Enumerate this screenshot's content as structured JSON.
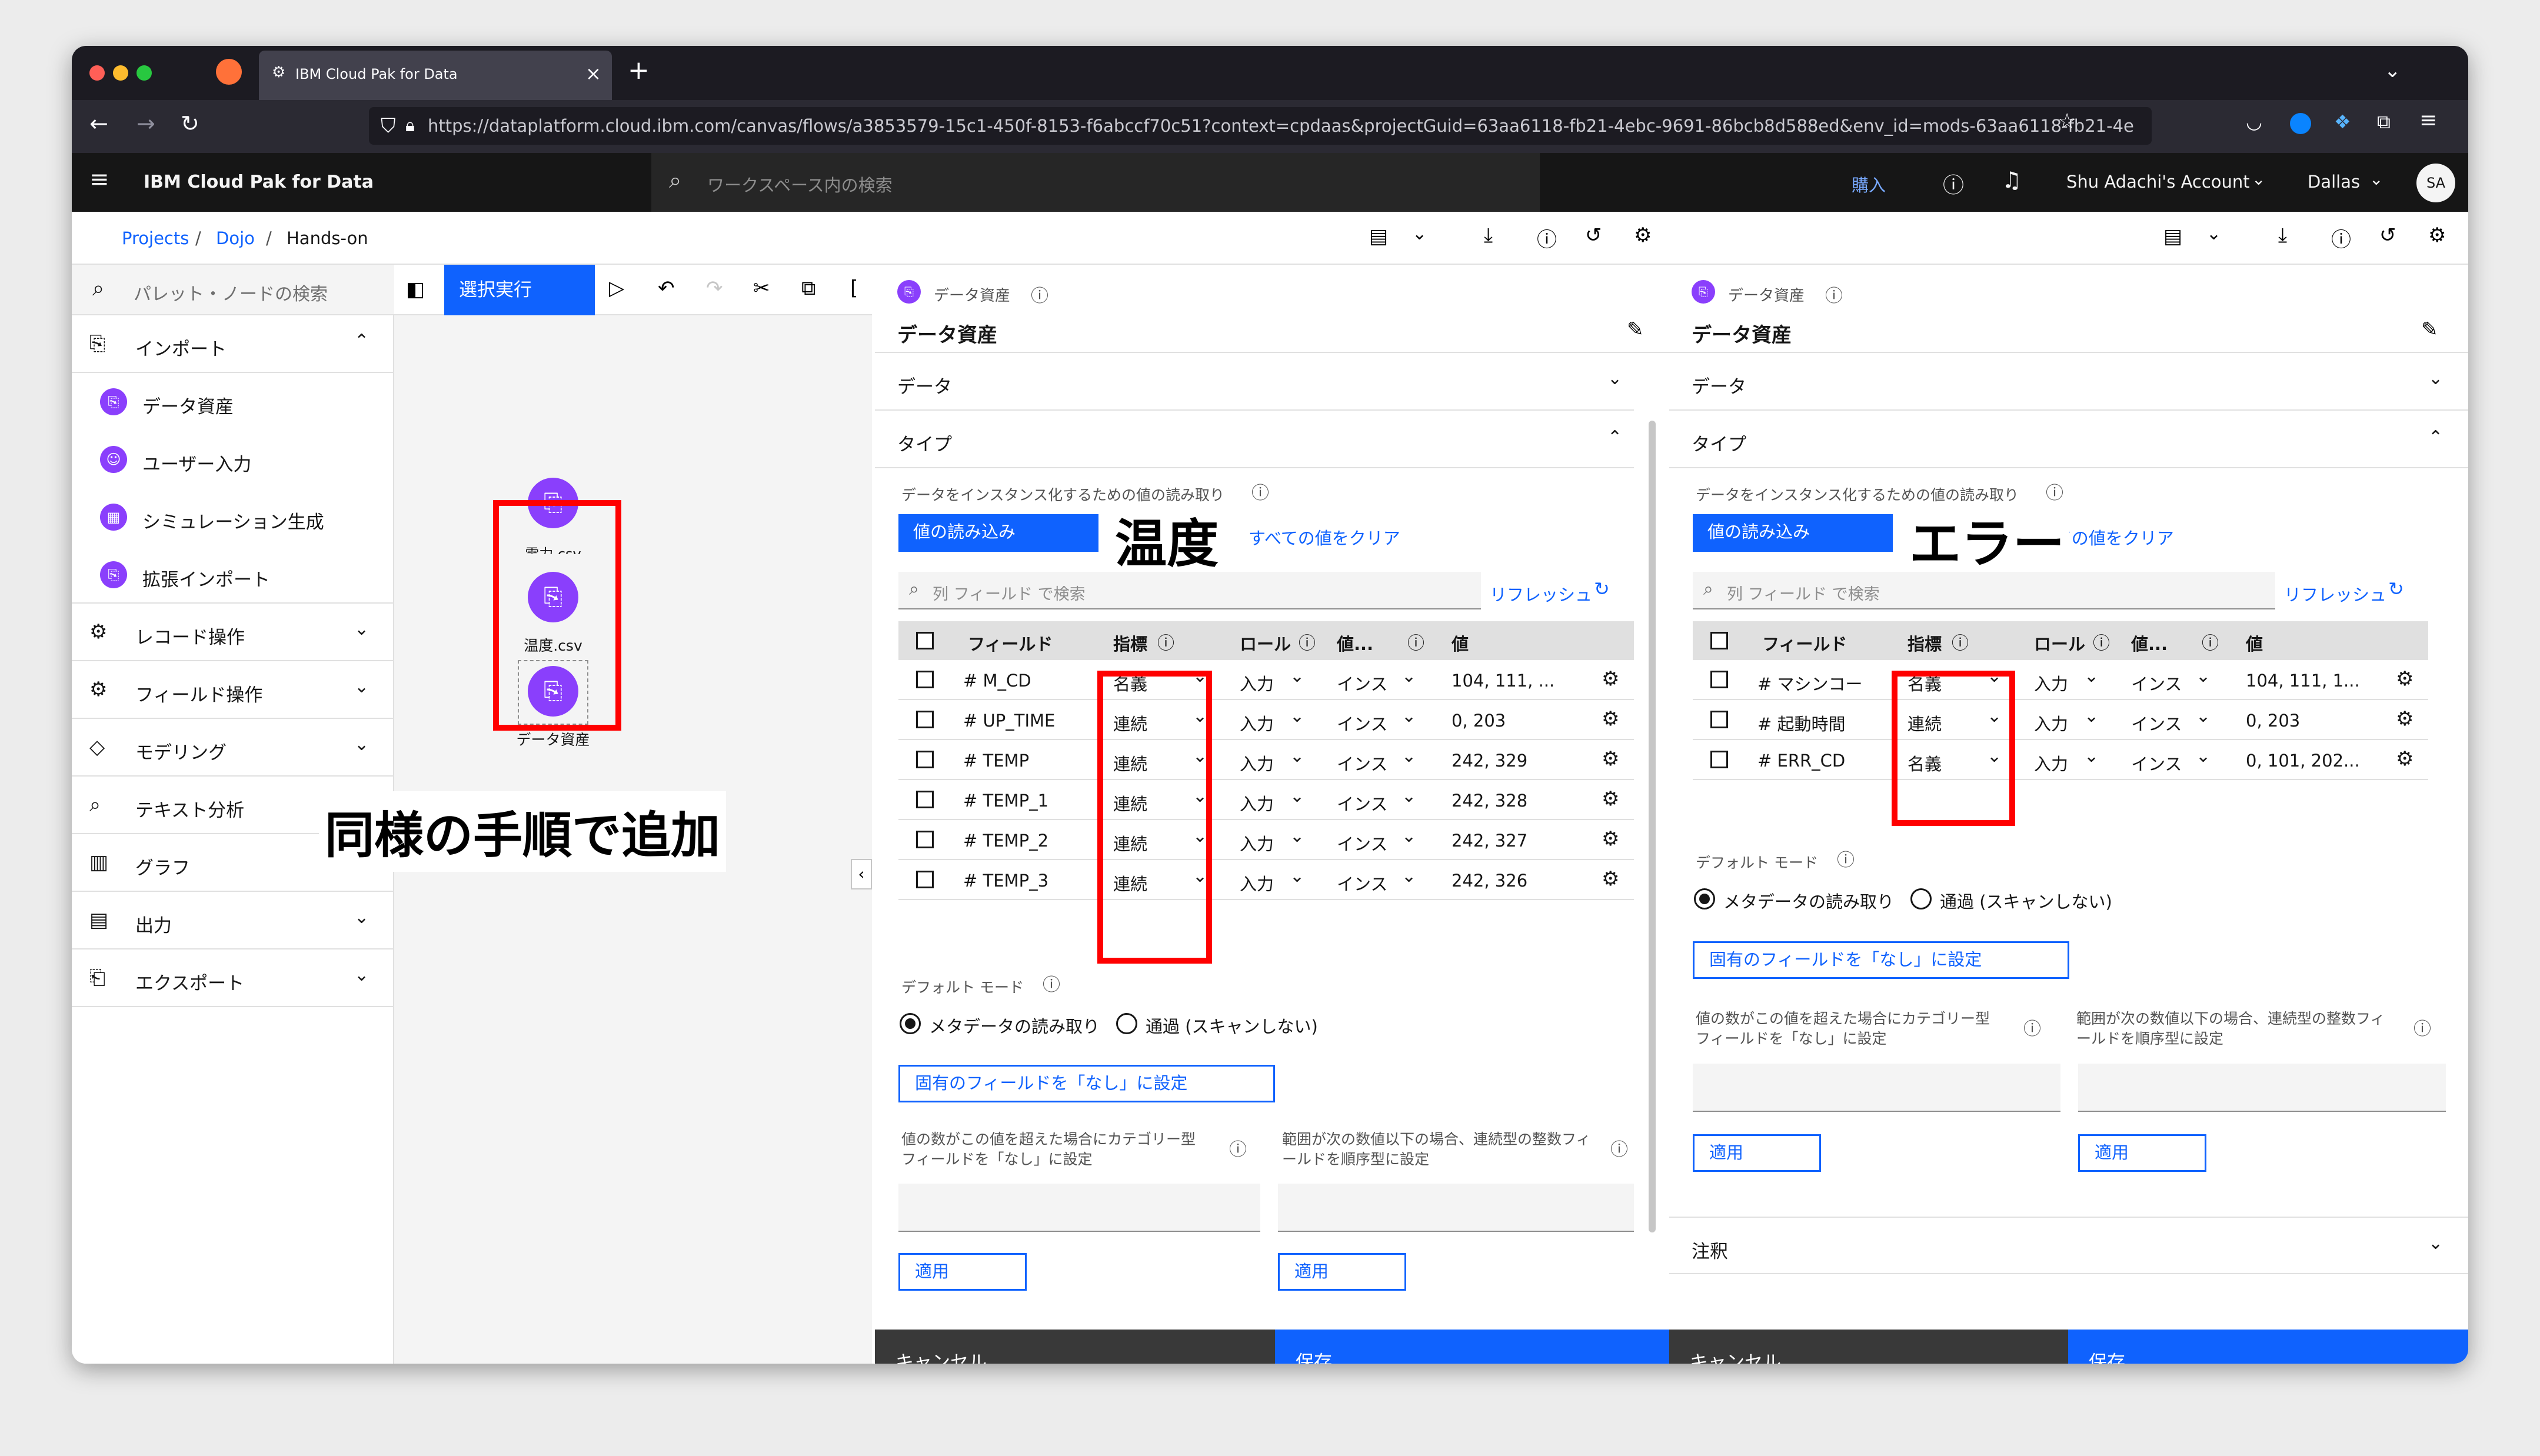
{
  "browser": {
    "tab_title": "IBM Cloud Pak for Data",
    "url": "https://dataplatform.cloud.ibm.com/canvas/flows/a3853579-15c1-450f-8153-f6abccf70c51?context=cpdaas&projectGuid=63aa6118-fb21-4ebc-9691-86bcb8d588ed&env_id=mods-63aa6118-fb21-4e"
  },
  "header": {
    "product": "IBM Cloud Pak for Data",
    "search_placeholder": "ワークスペース内の検索",
    "buy": "購入",
    "account": "Shu Adachi's Account",
    "region": "Dallas",
    "avatar": "SA"
  },
  "breadcrumb": [
    "Projects",
    "/",
    "Dojo",
    "/",
    "Hands-on"
  ],
  "palette": {
    "search_placeholder": "パレット・ノードの検索",
    "sections": [
      {
        "label": "インポート"
      },
      {
        "label": "レコード操作"
      },
      {
        "label": "フィールド操作"
      },
      {
        "label": "モデリング"
      },
      {
        "label": "テキスト分析"
      },
      {
        "label": "グラフ"
      },
      {
        "label": "出力"
      },
      {
        "label": "エクスポート"
      }
    ],
    "import_items": [
      "データ資産",
      "ユーザー入力",
      "シミュレーション生成",
      "拡張インポート"
    ]
  },
  "canvas": {
    "run_selected": "選択実行",
    "nodes": [
      "電力.csv",
      "温度.csv",
      "データ資産"
    ],
    "annotation": "同様の手順で追加"
  },
  "panel_left": {
    "subtitle": "データ資産",
    "title": "データ資産",
    "acc_data": "データ",
    "acc_type": "タイプ",
    "read_values_label": "データをインスタンス化するための値の読み取り",
    "read_values_btn": "値の読み込み",
    "clear_values": "すべての値をクリア",
    "annotation": "温度",
    "search_placeholder": "列 フィールド で検索",
    "refresh": "リフレッシュ",
    "columns": [
      "フィールド",
      "指標",
      "ロール",
      "値...",
      "値"
    ],
    "rows": [
      {
        "field": "# M_CD",
        "measure": "名義",
        "role": "入力",
        "vtype": "インス",
        "value": "104, 111, ..."
      },
      {
        "field": "# UP_TIME",
        "measure": "連続",
        "role": "入力",
        "vtype": "インス",
        "value": "0, 203"
      },
      {
        "field": "# TEMP",
        "measure": "連続",
        "role": "入力",
        "vtype": "インス",
        "value": "242, 329"
      },
      {
        "field": "# TEMP_1",
        "measure": "連続",
        "role": "入力",
        "vtype": "インス",
        "value": "242, 328"
      },
      {
        "field": "# TEMP_2",
        "measure": "連続",
        "role": "入力",
        "vtype": "インス",
        "value": "242, 327"
      },
      {
        "field": "# TEMP_3",
        "measure": "連続",
        "role": "入力",
        "vtype": "インス",
        "value": "242, 326"
      }
    ],
    "default_mode": "デフォルト モード",
    "radio_read": "メタデータの読み取り",
    "radio_pass": "通過 (スキャンしない)",
    "set_none_btn": "固有のフィールドを「なし」に設定",
    "cat_note": "値の数がこの値を超えた場合にカテゴリー型フィールドを「なし」に設定",
    "ord_note": "範囲が次の数値以下の場合、連続型の整数フィールドを順序型に設定",
    "apply": "適用",
    "cancel": "キャンセル",
    "save": "保存"
  },
  "panel_right": {
    "subtitle": "データ資産",
    "title": "データ資産",
    "acc_data": "データ",
    "acc_type": "タイプ",
    "read_values_label": "データをインスタンス化するための値の読み取り",
    "read_values_btn": "値の読み込み",
    "clear_values": "すべての値をクリア",
    "annotation": "エラー",
    "search_placeholder": "列 フィールド で検索",
    "refresh": "リフレッシュ",
    "columns": [
      "フィールド",
      "指標",
      "ロール",
      "値...",
      "値"
    ],
    "rows": [
      {
        "field": "# マシンコー",
        "measure": "名義",
        "role": "入力",
        "vtype": "インス",
        "value": "104, 111, 1..."
      },
      {
        "field": "# 起動時間",
        "measure": "連続",
        "role": "入力",
        "vtype": "インス",
        "value": "0, 203"
      },
      {
        "field": "# ERR_CD",
        "measure": "名義",
        "role": "入力",
        "vtype": "インス",
        "value": "0, 101, 202..."
      }
    ],
    "default_mode": "デフォルト モード",
    "radio_read": "メタデータの読み取り",
    "radio_pass": "通過 (スキャンしない)",
    "set_none_btn": "固有のフィールドを「なし」に設定",
    "cat_note": "値の数がこの値を超えた場合にカテゴリー型フィールドを「なし」に設定",
    "ord_note": "範囲が次の数値以下の場合、連続型の整数フィールドを順序型に設定",
    "apply": "適用",
    "acc_notes": "注釈",
    "cancel": "キャンセル",
    "save": "保存"
  },
  "colors": {
    "accent": "#0f62fe",
    "node": "#8a3ffc",
    "highlight": "#ff0000"
  }
}
